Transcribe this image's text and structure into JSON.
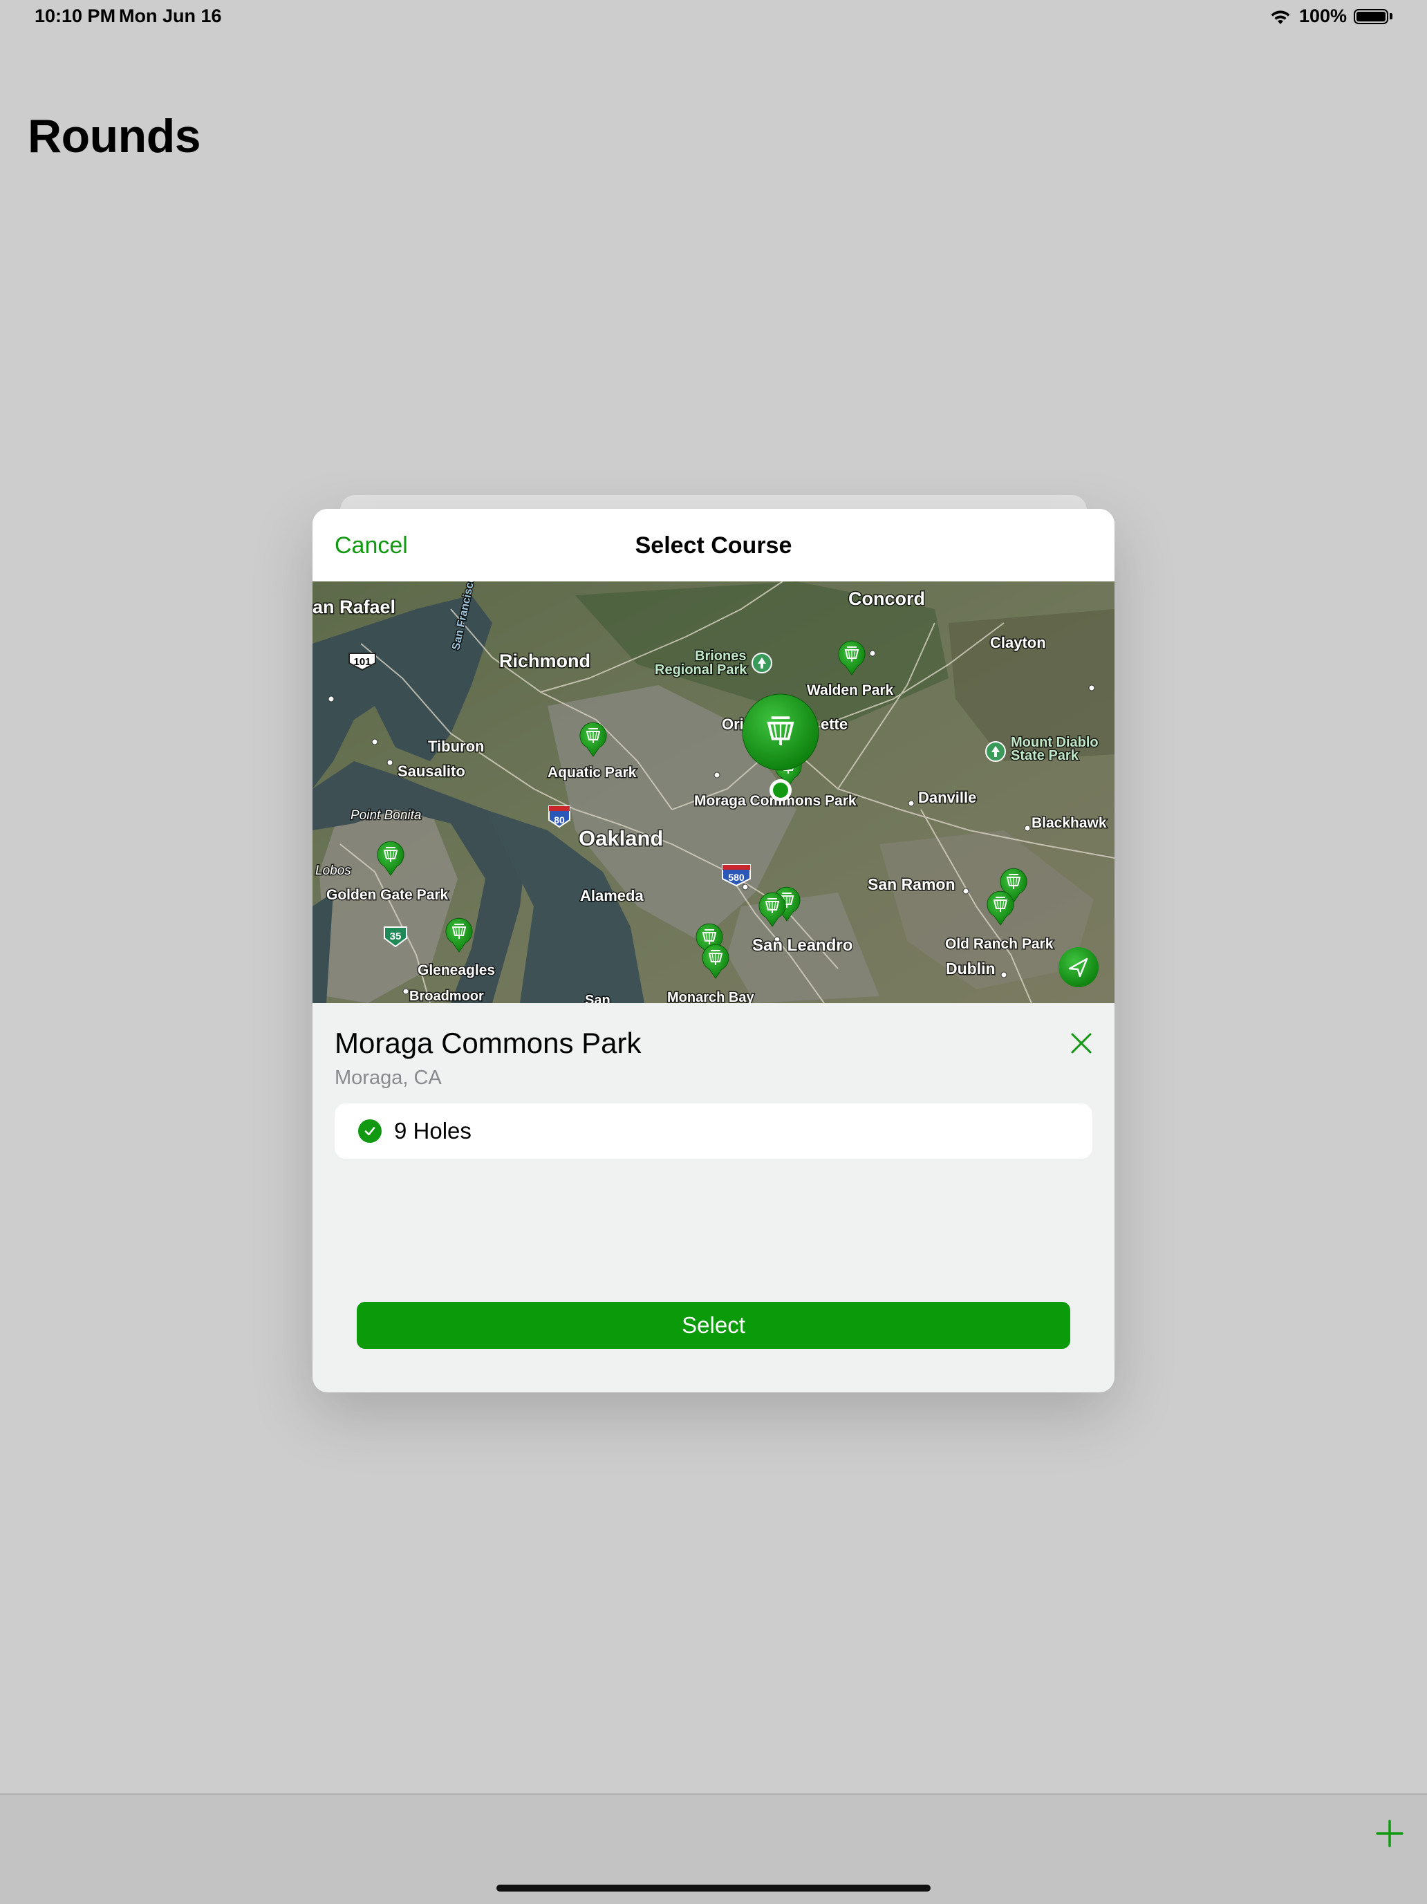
{
  "status_bar": {
    "time": "10:10 PM",
    "date": "Mon Jun 16",
    "battery": "100%"
  },
  "page": {
    "title": "Rounds"
  },
  "modal": {
    "cancel_label": "Cancel",
    "title": "Select Course",
    "map": {
      "labels": {
        "san_rafael": "an Rafael",
        "richmond": "Richmond",
        "concord": "Concord",
        "clayton": "Clayton",
        "briones": "Briones",
        "briones2": "Regional Park",
        "walden": "Walden Park",
        "ori": "Ori",
        "ette": "ette",
        "tiburon": "Tiburon",
        "sausalito": "Sausalito",
        "aquatic": "Aquatic Park",
        "moraga": "Moraga Commons Park",
        "danville": "Danville",
        "diablo": "Mount Diablo",
        "diablo2": "State Park",
        "blackhawk": "Blackhawk",
        "point_bonita": "Point Bonita",
        "oakland": "Oakland",
        "lobos": "Lobos",
        "golden_gate": "Golden Gate Park",
        "alameda": "Alameda",
        "san_ramon": "San Ramon",
        "old_ranch": "Old Ranch Park",
        "san_leandro": "San Leandro",
        "dublin": "Dublin",
        "gleneagles": "Gleneagles",
        "broadmoor": "Broadmoor",
        "san": "San",
        "monarch": "Monarch Bay",
        "shield_101": "101",
        "shield_80": "80",
        "shield_580": "580",
        "shield_35": "35",
        "sf_bay": "San Francisco"
      }
    },
    "course": {
      "name": "Moraga Commons Park",
      "location": "Moraga, CA"
    },
    "holes_option": "9 Holes",
    "select_label": "Select"
  },
  "colors": {
    "accent": "#119a11",
    "select_button": "#0a9a0a"
  }
}
